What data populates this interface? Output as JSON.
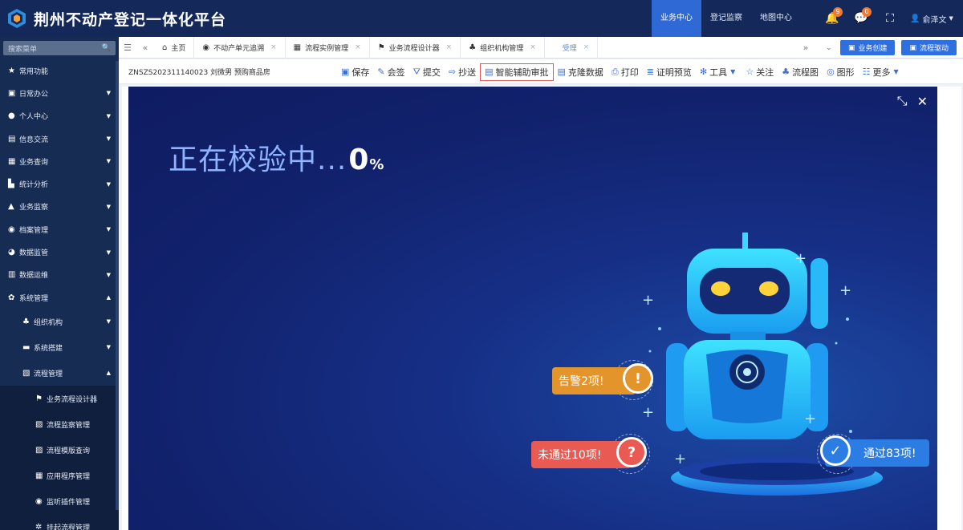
{
  "header": {
    "title": "荆州不动产登记一体化平台",
    "nav": [
      {
        "label": "业务中心",
        "active": true
      },
      {
        "label": "登记监察",
        "active": false
      },
      {
        "label": "地图中心",
        "active": false
      }
    ],
    "notifications": {
      "bell_count": "9",
      "message_count": "0"
    },
    "user": "俞泽文"
  },
  "sidebar": {
    "search_placeholder": "搜索菜单",
    "items": [
      {
        "label": "常用功能",
        "icon": "star-icon"
      },
      {
        "label": "日常办公",
        "icon": "briefcase-icon"
      },
      {
        "label": "个人中心",
        "icon": "user-icon"
      },
      {
        "label": "信息交流",
        "icon": "chat-icon"
      },
      {
        "label": "业务查询",
        "icon": "query-icon"
      },
      {
        "label": "统计分析",
        "icon": "chart-icon"
      },
      {
        "label": "业务监察",
        "icon": "bell-icon"
      },
      {
        "label": "档案管理",
        "icon": "globe-icon"
      },
      {
        "label": "数据监管",
        "icon": "pie-icon"
      },
      {
        "label": "数据运维",
        "icon": "doc-icon"
      },
      {
        "label": "系统管理",
        "icon": "gear-icon"
      }
    ],
    "sub_items": [
      {
        "label": "组织机构"
      },
      {
        "label": "系统搭建"
      },
      {
        "label": "流程管理"
      }
    ],
    "sub2_items": [
      {
        "label": "业务流程设计器"
      },
      {
        "label": "流程监察管理"
      },
      {
        "label": "流程模版查询"
      },
      {
        "label": "应用程序管理"
      },
      {
        "label": "监听插件管理"
      },
      {
        "label": "挂起流程管理"
      }
    ]
  },
  "tabs": [
    {
      "label": "主页",
      "closable": false
    },
    {
      "label": "不动产单元追溯",
      "closable": true
    },
    {
      "label": "流程实例管理",
      "closable": true
    },
    {
      "label": "业务流程设计器",
      "closable": true
    },
    {
      "label": "组织机构管理",
      "closable": true
    },
    {
      "label": "受理",
      "closable": true
    }
  ],
  "tab_actions": {
    "create": "业务创建",
    "drive": "流程驱动"
  },
  "toolbar": {
    "record": "ZNSZS202311140023 刘微男 预购商品房",
    "tools": [
      {
        "label": "保存",
        "icon": "save-icon"
      },
      {
        "label": "会签",
        "icon": "sign-icon"
      },
      {
        "label": "提交",
        "icon": "submit-icon"
      },
      {
        "label": "抄送",
        "icon": "cc-icon"
      },
      {
        "label": "智能辅助审批",
        "icon": "doc-icon"
      },
      {
        "label": "克隆数据",
        "icon": "clone-icon"
      },
      {
        "label": "打印",
        "icon": "print-icon"
      },
      {
        "label": "证明预览",
        "icon": "preview-icon"
      },
      {
        "label": "工具",
        "icon": "tool-icon"
      },
      {
        "label": "关注",
        "icon": "star-icon"
      },
      {
        "label": "流程图",
        "icon": "flow-icon"
      },
      {
        "label": "图形",
        "icon": "shape-icon"
      },
      {
        "label": "更多",
        "icon": "more-icon"
      }
    ]
  },
  "modal": {
    "status_text": "正在校验中...",
    "percent": "0",
    "percent_sign": "%",
    "warn": "告警2项!",
    "fail": "未通过10项!",
    "pass": "通过83项!"
  },
  "colors": {
    "header": "#14295a",
    "accent": "#2f6fe0",
    "warn": "#e3942b",
    "fail": "#e85a52",
    "pass": "#2c7de3"
  }
}
